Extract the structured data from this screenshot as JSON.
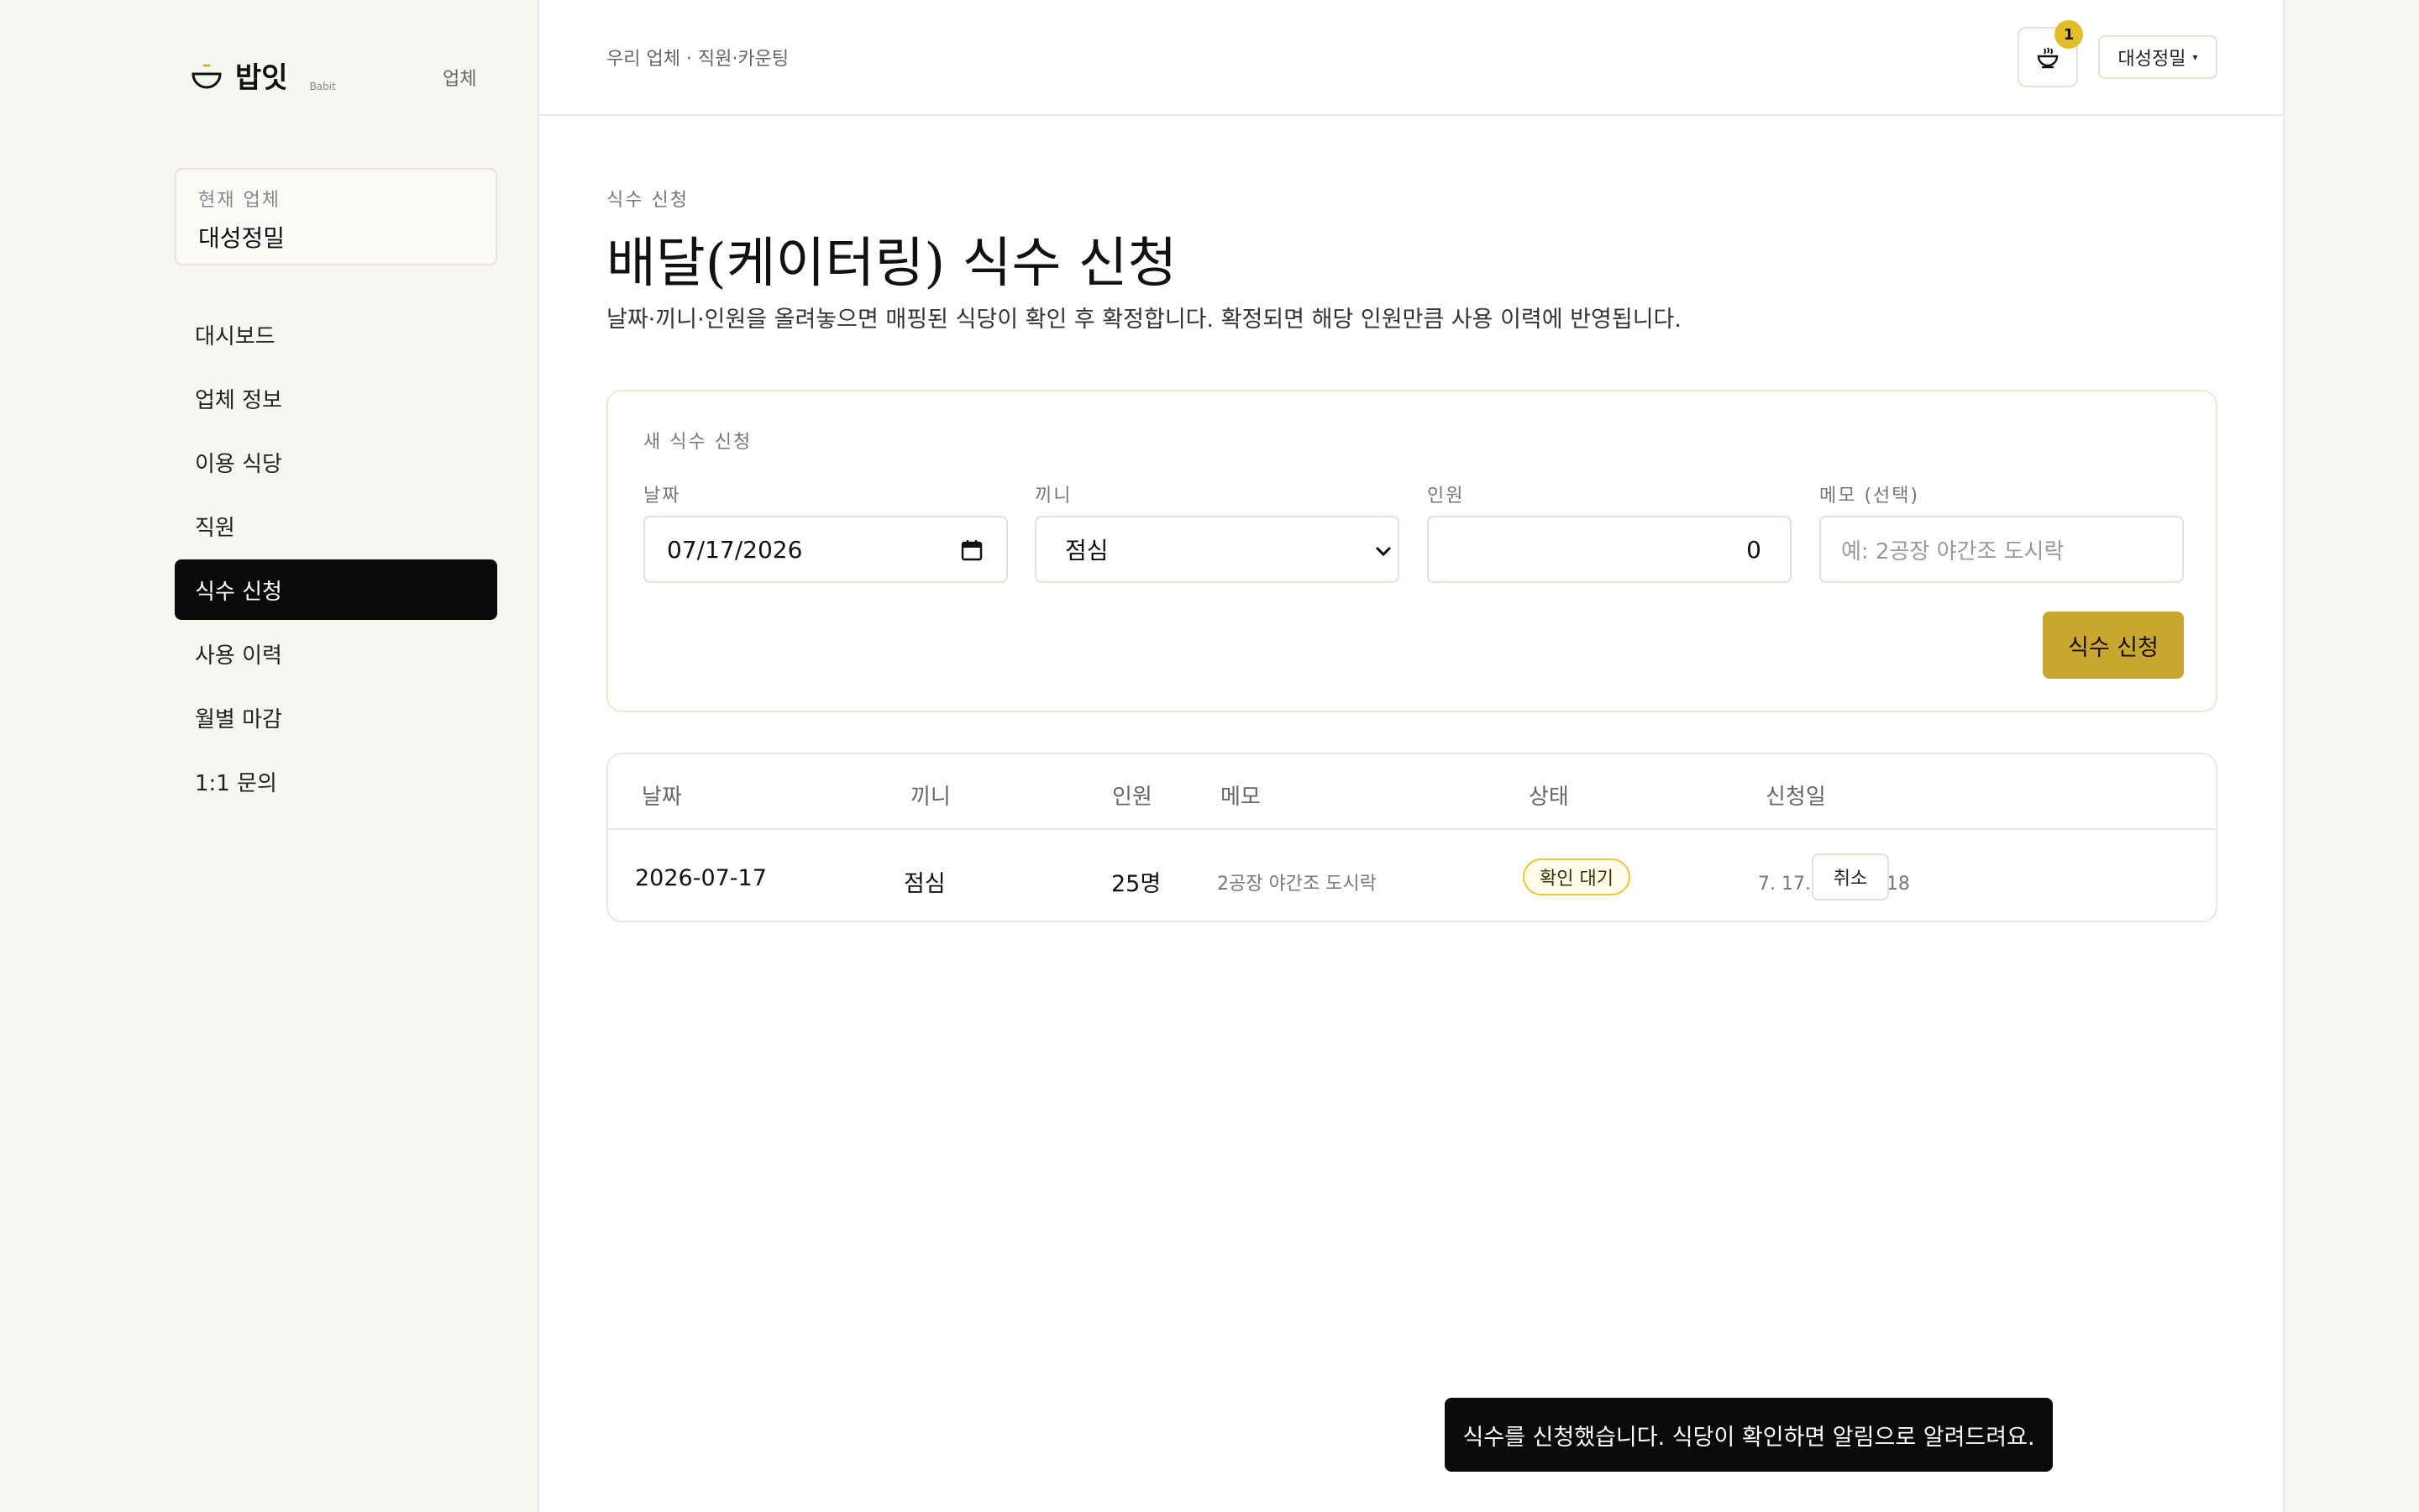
{
  "brand": {
    "name": "밥잇",
    "sub": "Babit",
    "role": "업체"
  },
  "sidebar": {
    "company_label": "현재 업체",
    "company_name": "대성정밀",
    "items": [
      {
        "label": "대시보드"
      },
      {
        "label": "업체 정보"
      },
      {
        "label": "이용 식당"
      },
      {
        "label": "직원"
      },
      {
        "label": "식수 신청",
        "active": true
      },
      {
        "label": "사용 이력"
      },
      {
        "label": "월별 마감"
      },
      {
        "label": "1:1 문의"
      }
    ]
  },
  "topbar": {
    "breadcrumb": "우리 업체 · 직원·카운팅",
    "notification_count": "1",
    "company_select": "대성정밀"
  },
  "page": {
    "eyebrow": "식수 신청",
    "title": "배달(케이터링) 식수 신청",
    "description": "날짜·끼니·인원을 올려놓으면 매핑된 식당이 확인 후 확정합니다. 확정되면 해당 인원만큼 사용 이력에 반영됩니다."
  },
  "form": {
    "title": "새 식수 신청",
    "date_label": "날짜",
    "date_value": "07/17/2026",
    "meal_label": "끼니",
    "meal_value": "점심",
    "count_label": "인원",
    "count_value": "0",
    "memo_label": "메모 (선택)",
    "memo_placeholder": "예: 2공장 야간조 도시락",
    "submit_label": "식수 신청"
  },
  "table": {
    "headers": [
      "날짜",
      "끼니",
      "인원",
      "메모",
      "상태",
      "신청일"
    ],
    "rows": [
      {
        "date": "2026-07-17",
        "meal": "점심",
        "count": "25명",
        "memo": "2공장 야간조 도시락",
        "status": "확인 대기",
        "requested_at": "7. 17. 오전 11:18",
        "action": "취소"
      }
    ]
  },
  "toast": {
    "message": "식수를 신청했습니다. 식당이 확인하면 알림으로 알려드려요."
  },
  "colors": {
    "accent": "#c9a62f",
    "badge": "#e2bd2a",
    "sidebar_bg": "#f8f6f1",
    "active_nav": "#0a0a0a"
  }
}
